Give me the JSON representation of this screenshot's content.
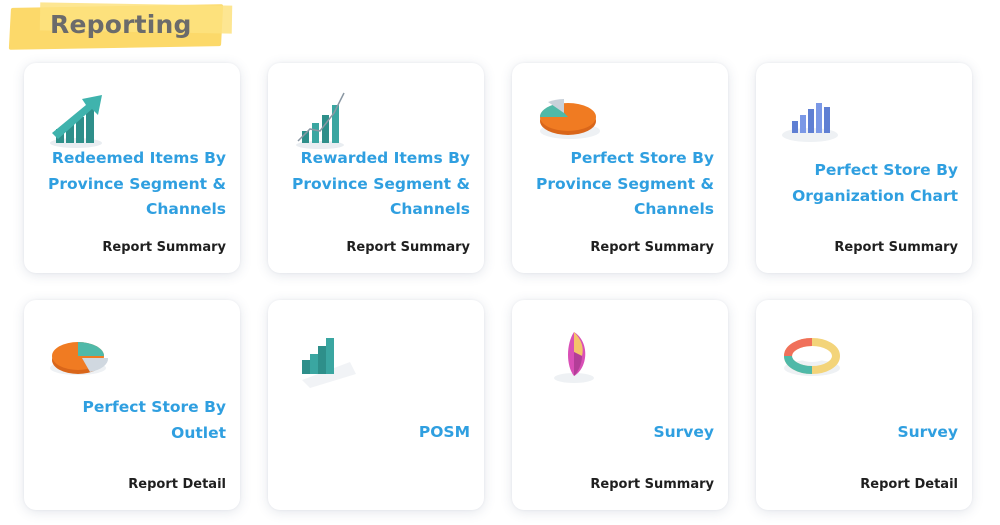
{
  "page": {
    "title": "Reporting"
  },
  "cards": [
    {
      "title_lines": [
        "Redeemed Items By",
        "Province Segment &",
        "Channels"
      ],
      "subtitle": "Report Summary",
      "icon": "growth-chart-icon"
    },
    {
      "title_lines": [
        "Rewarded Items By",
        "Province Segment &",
        "Channels"
      ],
      "subtitle": "Report Summary",
      "icon": "rising-bars-icon"
    },
    {
      "title_lines": [
        "Perfect Store By",
        "Province Segment &",
        "Channels"
      ],
      "subtitle": "Report Summary",
      "icon": "pie-chart-icon"
    },
    {
      "title_lines": [
        "Perfect Store By",
        "Organization Chart"
      ],
      "subtitle": "Report Summary",
      "icon": "bar-chart-icon"
    },
    {
      "title_lines": [
        "Perfect Store By",
        "Outlet"
      ],
      "subtitle": "Report Detail",
      "icon": "pie-chart-icon"
    },
    {
      "title_lines": [
        "POSM"
      ],
      "subtitle": "",
      "icon": "stair-bars-icon"
    },
    {
      "title_lines": [
        "Survey"
      ],
      "subtitle": "Report Summary",
      "icon": "pie-slice-icon"
    },
    {
      "title_lines": [
        "Survey"
      ],
      "subtitle": "Report Detail",
      "icon": "donut-chart-icon"
    }
  ],
  "colors": {
    "accent": "#2f9fe0",
    "highlight": "#fcd96a",
    "teal": "#3aa6a1",
    "orange": "#f07b22"
  }
}
